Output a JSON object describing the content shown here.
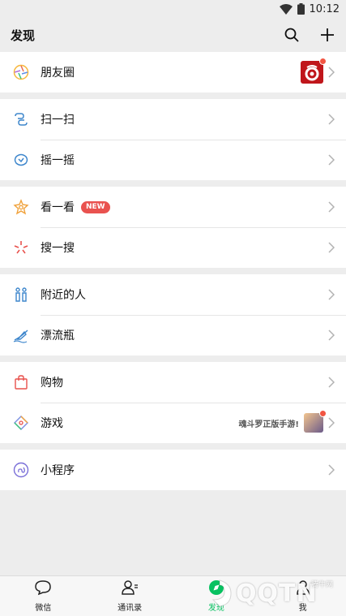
{
  "status_bar": {
    "time": "10:12"
  },
  "header": {
    "title": "发现"
  },
  "groups": [
    {
      "items": [
        {
          "label": "朋友圈"
        }
      ]
    },
    {
      "items": [
        {
          "label": "扫一扫"
        },
        {
          "label": "摇一摇"
        }
      ]
    },
    {
      "items": [
        {
          "label": "看一看",
          "badge": "NEW"
        },
        {
          "label": "搜一搜"
        }
      ]
    },
    {
      "items": [
        {
          "label": "附近的人"
        },
        {
          "label": "漂流瓶"
        }
      ]
    },
    {
      "items": [
        {
          "label": "购物"
        },
        {
          "label": "游戏",
          "promo": "魂斗罗正版手游!"
        }
      ]
    },
    {
      "items": [
        {
          "label": "小程序"
        }
      ]
    }
  ],
  "tabs": [
    {
      "label": "微信"
    },
    {
      "label": "通讯录"
    },
    {
      "label": "发现"
    },
    {
      "label": "我"
    }
  ],
  "watermark": {
    "text": "QQTN",
    "small": "腾牛网"
  },
  "colors": {
    "accent": "#07c160",
    "badge": "#e9524f",
    "background": "#ededed"
  }
}
